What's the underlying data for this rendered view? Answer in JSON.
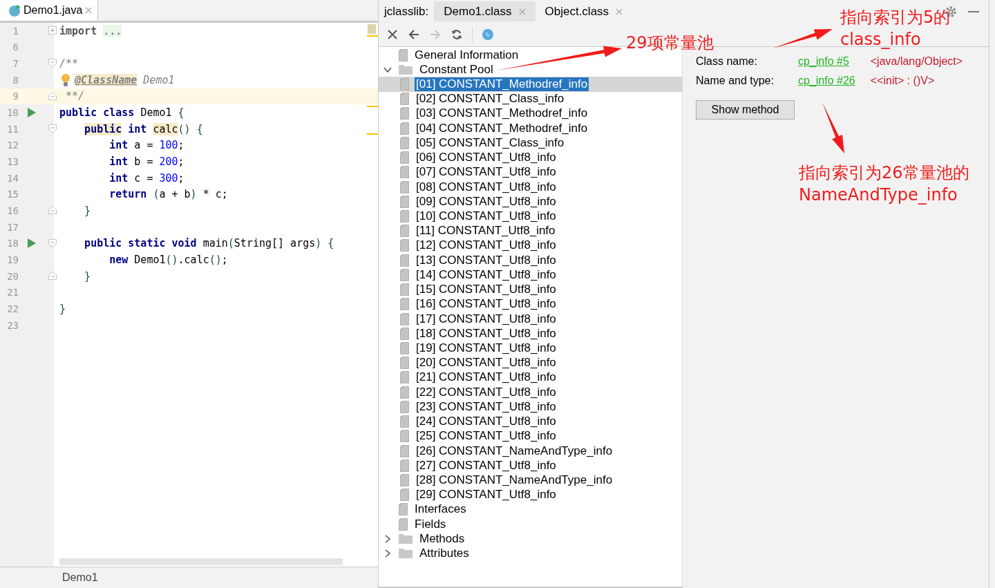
{
  "editor": {
    "tab": {
      "label": "Demo1.java",
      "selected": true
    },
    "lines": [
      {
        "number": "1",
        "fold": {
          "kind": "expand"
        },
        "run": false,
        "bulb": false,
        "current": false,
        "tokens": [
          {
            "text": "import",
            "kind": "import"
          },
          {
            "kind": "space"
          },
          {
            "text": "...",
            "kind": "folded"
          }
        ]
      },
      {
        "number": "6",
        "run": false,
        "bulb": false,
        "current": false
      },
      {
        "number": "7",
        "fold": {
          "kind": "open"
        },
        "run": false,
        "bulb": false,
        "current": false,
        "tokens": [
          {
            "text": "/**",
            "kind": "comment"
          }
        ]
      },
      {
        "number": "8",
        "run": false,
        "bulb": true,
        "current": false,
        "tokens": [
          {
            "text": "@ClassName",
            "kind": "doc-tag"
          },
          {
            "text": " Demo1",
            "kind": "comment"
          }
        ]
      },
      {
        "number": "9",
        "fold": {
          "kind": "close"
        },
        "run": false,
        "bulb": false,
        "current": true,
        "tokens": [
          {
            "text": " **/",
            "kind": "comment"
          }
        ]
      },
      {
        "number": "10",
        "run": true,
        "bulb": false,
        "current": false,
        "tokens": [
          {
            "text": "public",
            "kind": "keyword"
          },
          {
            "kind": "space"
          },
          {
            "text": "class",
            "kind": "keyword"
          },
          {
            "text": " Demo1 ",
            "kind": "text"
          },
          {
            "text": "{",
            "kind": "bracket"
          }
        ]
      },
      {
        "number": "11",
        "fold": {
          "kind": "open"
        },
        "run": false,
        "bulb": false,
        "current": false,
        "tokens": [
          {
            "kind": "indent"
          },
          {
            "text": "public",
            "kind": "keyword-marked"
          },
          {
            "kind": "space"
          },
          {
            "text": "int",
            "kind": "keyword"
          },
          {
            "kind": "space"
          },
          {
            "text": "calc",
            "kind": "text-marked"
          },
          {
            "text": "()",
            "kind": "bracket"
          },
          {
            "kind": "space"
          },
          {
            "text": "{",
            "kind": "bracket"
          }
        ]
      },
      {
        "number": "12",
        "run": false,
        "bulb": false,
        "current": false,
        "tokens": [
          {
            "kind": "indent"
          },
          {
            "kind": "indent"
          },
          {
            "text": "int",
            "kind": "keyword"
          },
          {
            "text": " a = ",
            "kind": "text"
          },
          {
            "text": "100",
            "kind": "number"
          },
          {
            "text": ";",
            "kind": "text"
          }
        ]
      },
      {
        "number": "13",
        "run": false,
        "bulb": false,
        "current": false,
        "tokens": [
          {
            "kind": "indent"
          },
          {
            "kind": "indent"
          },
          {
            "text": "int",
            "kind": "keyword"
          },
          {
            "text": " b = ",
            "kind": "text"
          },
          {
            "text": "200",
            "kind": "number"
          },
          {
            "text": ";",
            "kind": "text"
          }
        ]
      },
      {
        "number": "14",
        "run": false,
        "bulb": false,
        "current": false,
        "tokens": [
          {
            "kind": "indent"
          },
          {
            "kind": "indent"
          },
          {
            "text": "int",
            "kind": "keyword"
          },
          {
            "text": " c = ",
            "kind": "text"
          },
          {
            "text": "300",
            "kind": "number"
          },
          {
            "text": ";",
            "kind": "text"
          }
        ]
      },
      {
        "number": "15",
        "run": false,
        "bulb": false,
        "current": false,
        "tokens": [
          {
            "kind": "indent"
          },
          {
            "kind": "indent"
          },
          {
            "text": "return",
            "kind": "keyword"
          },
          {
            "kind": "space"
          },
          {
            "text": "(",
            "kind": "bracket"
          },
          {
            "text": "a + b",
            "kind": "text"
          },
          {
            "text": ")",
            "kind": "bracket"
          },
          {
            "text": " * c;",
            "kind": "text"
          }
        ]
      },
      {
        "number": "16",
        "fold": {
          "kind": "close"
        },
        "run": false,
        "bulb": false,
        "current": false,
        "tokens": [
          {
            "kind": "indent"
          },
          {
            "text": "}",
            "kind": "bracket"
          }
        ]
      },
      {
        "number": "17",
        "run": false,
        "bulb": false,
        "current": false
      },
      {
        "number": "18",
        "fold": {
          "kind": "open"
        },
        "run": true,
        "bulb": false,
        "current": false,
        "tokens": [
          {
            "kind": "indent"
          },
          {
            "text": "public",
            "kind": "keyword"
          },
          {
            "kind": "space"
          },
          {
            "text": "static",
            "kind": "keyword"
          },
          {
            "kind": "space"
          },
          {
            "text": "void",
            "kind": "keyword"
          },
          {
            "text": " main",
            "kind": "text"
          },
          {
            "text": "(",
            "kind": "bracket"
          },
          {
            "text": "String[] args",
            "kind": "text"
          },
          {
            "text": ")",
            "kind": "bracket"
          },
          {
            "kind": "space"
          },
          {
            "text": "{",
            "kind": "bracket"
          }
        ]
      },
      {
        "number": "19",
        "run": false,
        "bulb": false,
        "current": false,
        "tokens": [
          {
            "kind": "indent"
          },
          {
            "kind": "indent"
          },
          {
            "text": "new",
            "kind": "keyword"
          },
          {
            "text": " Demo1",
            "kind": "text"
          },
          {
            "text": "()",
            "kind": "bracket"
          },
          {
            "text": ".calc",
            "kind": "text"
          },
          {
            "text": "()",
            "kind": "bracket"
          },
          {
            "text": ";",
            "kind": "text"
          }
        ]
      },
      {
        "number": "20",
        "fold": {
          "kind": "close"
        },
        "run": false,
        "bulb": false,
        "current": false,
        "tokens": [
          {
            "kind": "indent"
          },
          {
            "text": "}",
            "kind": "bracket"
          }
        ]
      },
      {
        "number": "21",
        "run": false,
        "bulb": false,
        "current": false
      },
      {
        "number": "22",
        "run": false,
        "bulb": false,
        "current": false,
        "tokens": [
          {
            "text": "}",
            "kind": "bracket"
          }
        ]
      },
      {
        "number": "23",
        "run": false,
        "bulb": false,
        "current": false
      }
    ],
    "status": "Demo1"
  },
  "class_view": {
    "title": "jclasslib:",
    "tabs": [
      {
        "label": "Demo1.class",
        "selected": true
      },
      {
        "label": "Object.class",
        "selected": false
      }
    ],
    "toolbar": [
      {
        "kind": "close",
        "disabled": false
      },
      {
        "kind": "back",
        "disabled": false
      },
      {
        "kind": "forward",
        "disabled": true
      },
      {
        "kind": "refresh",
        "disabled": false
      },
      {
        "kind": "globe",
        "disabled": false
      }
    ],
    "tree": {
      "items": [
        {
          "label": "General Information",
          "kind": "leaf",
          "selected": false
        },
        {
          "label": "Constant Pool",
          "kind": "folder",
          "expanded": true,
          "selected": false,
          "children": [
            {
              "label": "[01] CONSTANT_Methodref_info",
              "selected": true
            },
            {
              "label": "[02] CONSTANT_Class_info",
              "selected": false
            },
            {
              "label": "[03] CONSTANT_Methodref_info",
              "selected": false
            },
            {
              "label": "[04] CONSTANT_Methodref_info",
              "selected": false
            },
            {
              "label": "[05] CONSTANT_Class_info",
              "selected": false
            },
            {
              "label": "[06] CONSTANT_Utf8_info",
              "selected": false
            },
            {
              "label": "[07] CONSTANT_Utf8_info",
              "selected": false
            },
            {
              "label": "[08] CONSTANT_Utf8_info",
              "selected": false
            },
            {
              "label": "[09] CONSTANT_Utf8_info",
              "selected": false
            },
            {
              "label": "[10] CONSTANT_Utf8_info",
              "selected": false
            },
            {
              "label": "[11] CONSTANT_Utf8_info",
              "selected": false
            },
            {
              "label": "[12] CONSTANT_Utf8_info",
              "selected": false
            },
            {
              "label": "[13] CONSTANT_Utf8_info",
              "selected": false
            },
            {
              "label": "[14] CONSTANT_Utf8_info",
              "selected": false
            },
            {
              "label": "[15] CONSTANT_Utf8_info",
              "selected": false
            },
            {
              "label": "[16] CONSTANT_Utf8_info",
              "selected": false
            },
            {
              "label": "[17] CONSTANT_Utf8_info",
              "selected": false
            },
            {
              "label": "[18] CONSTANT_Utf8_info",
              "selected": false
            },
            {
              "label": "[19] CONSTANT_Utf8_info",
              "selected": false
            },
            {
              "label": "[20] CONSTANT_Utf8_info",
              "selected": false
            },
            {
              "label": "[21] CONSTANT_Utf8_info",
              "selected": false
            },
            {
              "label": "[22] CONSTANT_Utf8_info",
              "selected": false
            },
            {
              "label": "[23] CONSTANT_Utf8_info",
              "selected": false
            },
            {
              "label": "[24] CONSTANT_Utf8_info",
              "selected": false
            },
            {
              "label": "[25] CONSTANT_Utf8_info",
              "selected": false
            },
            {
              "label": "[26] CONSTANT_NameAndType_info",
              "selected": false
            },
            {
              "label": "[27] CONSTANT_Utf8_info",
              "selected": false
            },
            {
              "label": "[28] CONSTANT_NameAndType_info",
              "selected": false
            },
            {
              "label": "[29] CONSTANT_Utf8_info",
              "selected": false
            }
          ]
        },
        {
          "label": "Interfaces",
          "kind": "leaf",
          "selected": false
        },
        {
          "label": "Fields",
          "kind": "leaf",
          "selected": false
        },
        {
          "label": "Methods",
          "kind": "folder",
          "expanded": false,
          "selected": false
        },
        {
          "label": "Attributes",
          "kind": "folder",
          "expanded": false,
          "selected": false
        }
      ]
    },
    "details": {
      "fields": [
        {
          "label": "Class name:",
          "link": "cp_info #5",
          "value": "<java/lang/Object>"
        },
        {
          "label": "Name and type:",
          "link": "cp_info #26",
          "value": "<<init> : ()V>"
        }
      ],
      "button": "Show method"
    }
  },
  "annotations": [
    {
      "lines": [
        "29项常量池"
      ]
    },
    {
      "lines": [
        "指向索引为5的",
        "class_info"
      ]
    },
    {
      "lines": [
        "指向索引为26常量池的",
        "NameAndType_info"
      ]
    }
  ]
}
